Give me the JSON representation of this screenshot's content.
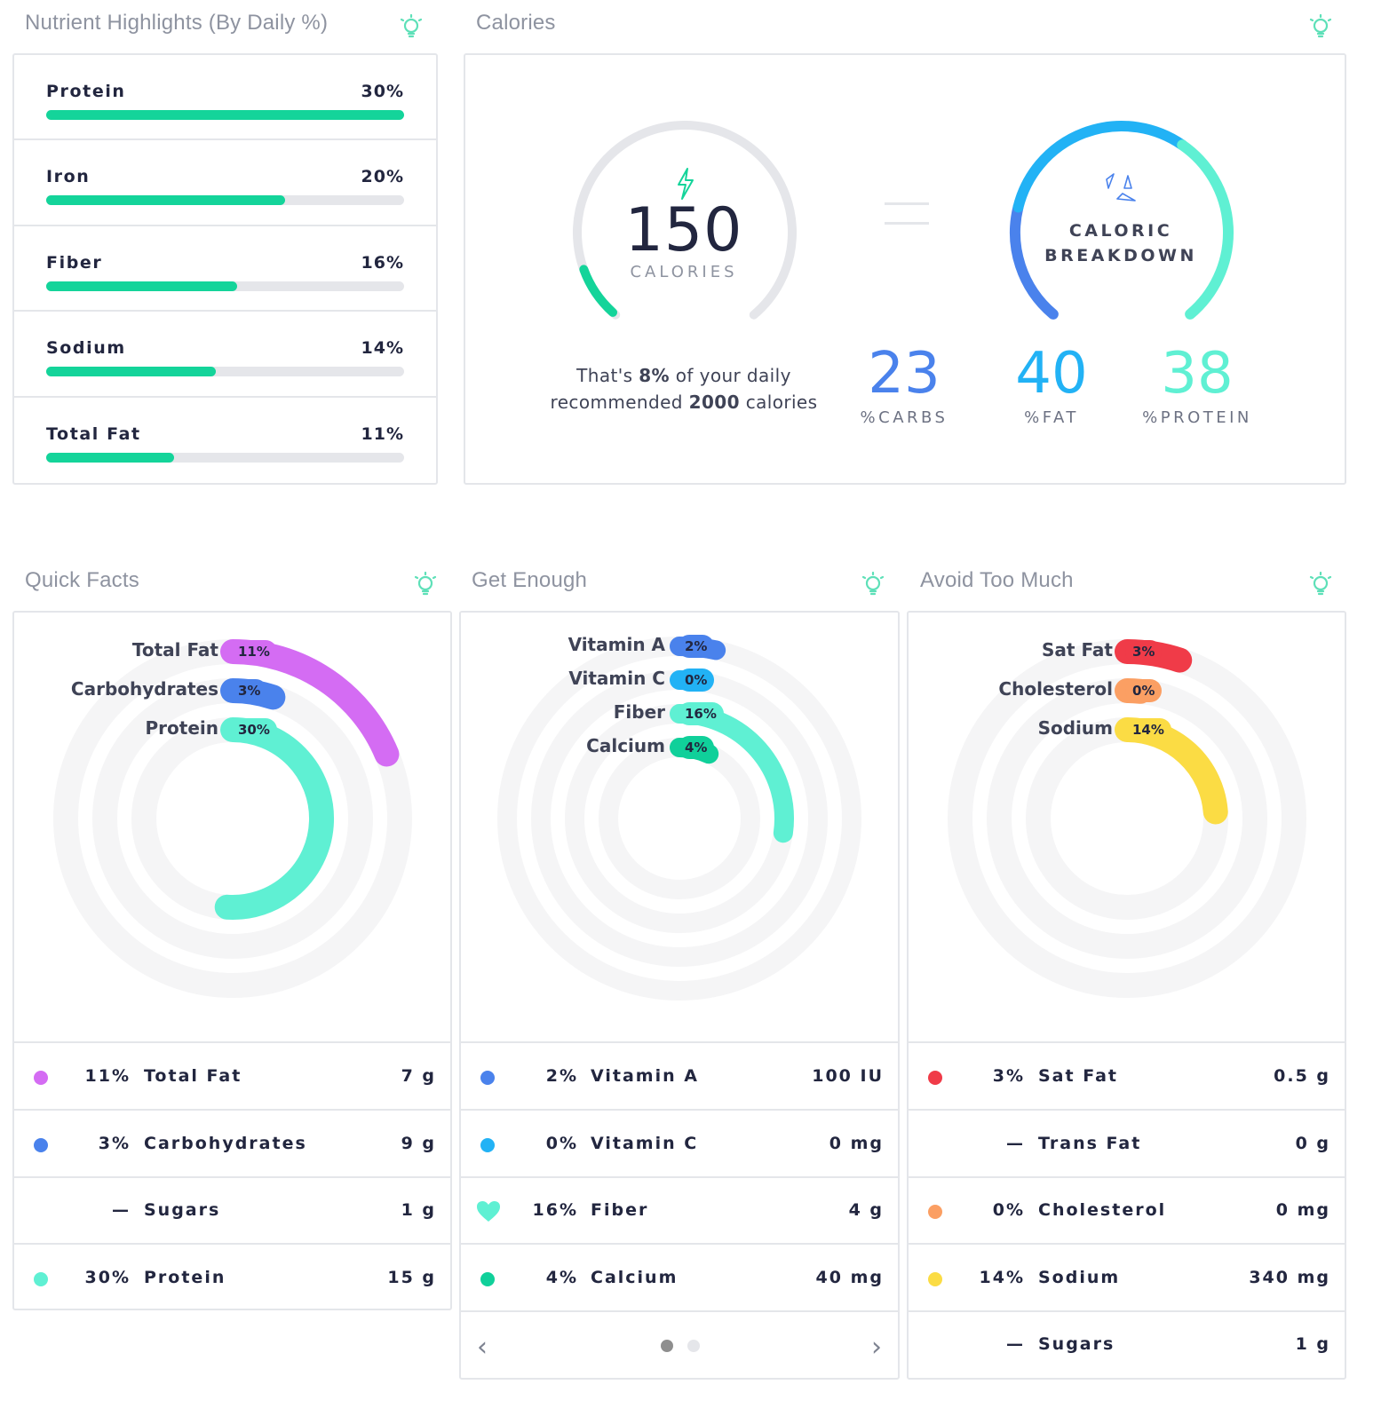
{
  "colors": {
    "green": "#14d49a",
    "teal": "#5ff0d3",
    "purple": "#d46cf3",
    "blue": "#4a82ec",
    "skyblue": "#22b2f5",
    "red": "#f03b48",
    "orange": "#fb9f63",
    "yellow": "#fbdc44",
    "calcium": "#10d09a",
    "bulb": "#5ee0b8"
  },
  "nutrient_highlights": {
    "title": "Nutrient Highlights (By Daily %)",
    "icon": "lightbulb-icon",
    "items": [
      {
        "name": "Protein",
        "pct_label": "30%",
        "fraction": 1.0
      },
      {
        "name": "Iron",
        "pct_label": "20%",
        "fraction": 0.667
      },
      {
        "name": "Fiber",
        "pct_label": "16%",
        "fraction": 0.533
      },
      {
        "name": "Sodium",
        "pct_label": "14%",
        "fraction": 0.473
      },
      {
        "name": "Total Fat",
        "pct_label": "11%",
        "fraction": 0.358
      }
    ]
  },
  "calories": {
    "title": "Calories",
    "icon": "lightbulb-icon",
    "value": "150",
    "unit": "CALORIES",
    "gauge_fraction": 0.08,
    "note_pre": "That's ",
    "note_pct": "8%",
    "note_mid": " of your daily",
    "note_line2_pre": "recommended ",
    "note_total": "2000",
    "note_line2_post": " calories",
    "breakdown_label_1": "CALORIC",
    "breakdown_label_2": "BREAKDOWN",
    "macros": [
      {
        "value": "23",
        "label": "%CARBS",
        "color": "#4a82ec"
      },
      {
        "value": "40",
        "label": "%FAT",
        "color": "#22b2f5"
      },
      {
        "value": "38",
        "label": "%PROTEIN",
        "color": "#5ff0d3"
      }
    ]
  },
  "quick_facts": {
    "title": "Quick Facts",
    "icon": "lightbulb-icon",
    "rings": [
      {
        "label": "Total Fat",
        "pct": "11%",
        "value": 11,
        "color": "#d46cf3"
      },
      {
        "label": "Carbohydrates",
        "pct": "3%",
        "value": 3,
        "color": "#4a82ec"
      },
      {
        "label": "Protein",
        "pct": "30%",
        "value": 30,
        "color": "#5ff0d3"
      }
    ],
    "rows": [
      {
        "pct": "11%",
        "name": "Total Fat",
        "value": "7 g",
        "dot": "#d46cf3"
      },
      {
        "pct": "3%",
        "name": "Carbohydrates",
        "value": "9 g",
        "dot": "#4a82ec"
      },
      {
        "pct": "—",
        "name": "Sugars",
        "value": "1 g",
        "dot": ""
      },
      {
        "pct": "30%",
        "name": "Protein",
        "value": "15 g",
        "dot": "#5ff0d3"
      }
    ]
  },
  "get_enough": {
    "title": "Get Enough",
    "icon": "lightbulb-icon",
    "rings": [
      {
        "label": "Vitamin A",
        "pct": "2%",
        "value": 2,
        "color": "#4a82ec"
      },
      {
        "label": "Vitamin C",
        "pct": "0%",
        "value": 0,
        "color": "#22b2f5"
      },
      {
        "label": "Fiber",
        "pct": "16%",
        "value": 16,
        "color": "#5ff0d3"
      },
      {
        "label": "Calcium",
        "pct": "4%",
        "value": 4,
        "color": "#10d09a"
      }
    ],
    "rows": [
      {
        "pct": "2%",
        "name": "Vitamin A",
        "value": "100 IU",
        "dot": "#4a82ec"
      },
      {
        "pct": "0%",
        "name": "Vitamin C",
        "value": "0 mg",
        "dot": "#22b2f5"
      },
      {
        "pct": "16%",
        "name": "Fiber",
        "value": "4 g",
        "dot": "#5ff0d3",
        "icon": "heart-icon"
      },
      {
        "pct": "4%",
        "name": "Calcium",
        "value": "40 mg",
        "dot": "#10d09a"
      }
    ],
    "pager": {
      "prev": "‹",
      "next": "›",
      "pages": 2,
      "current": 1
    }
  },
  "avoid_too_much": {
    "title": "Avoid Too Much",
    "icon": "lightbulb-icon",
    "rings": [
      {
        "label": "Sat Fat",
        "pct": "3%",
        "value": 3,
        "color": "#f03b48"
      },
      {
        "label": "Cholesterol",
        "pct": "0%",
        "value": 0,
        "color": "#fb9f63"
      },
      {
        "label": "Sodium",
        "pct": "14%",
        "value": 14,
        "color": "#fbdc44"
      }
    ],
    "rows": [
      {
        "pct": "3%",
        "name": "Sat Fat",
        "value": "0.5 g",
        "dot": "#f03b48"
      },
      {
        "pct": "—",
        "name": "Trans Fat",
        "value": "0 g",
        "dot": ""
      },
      {
        "pct": "0%",
        "name": "Cholesterol",
        "value": "0 mg",
        "dot": "#fb9f63"
      },
      {
        "pct": "14%",
        "name": "Sodium",
        "value": "340 mg",
        "dot": "#fbdc44"
      },
      {
        "pct": "—",
        "name": "Sugars",
        "value": "1 g",
        "dot": ""
      }
    ]
  }
}
